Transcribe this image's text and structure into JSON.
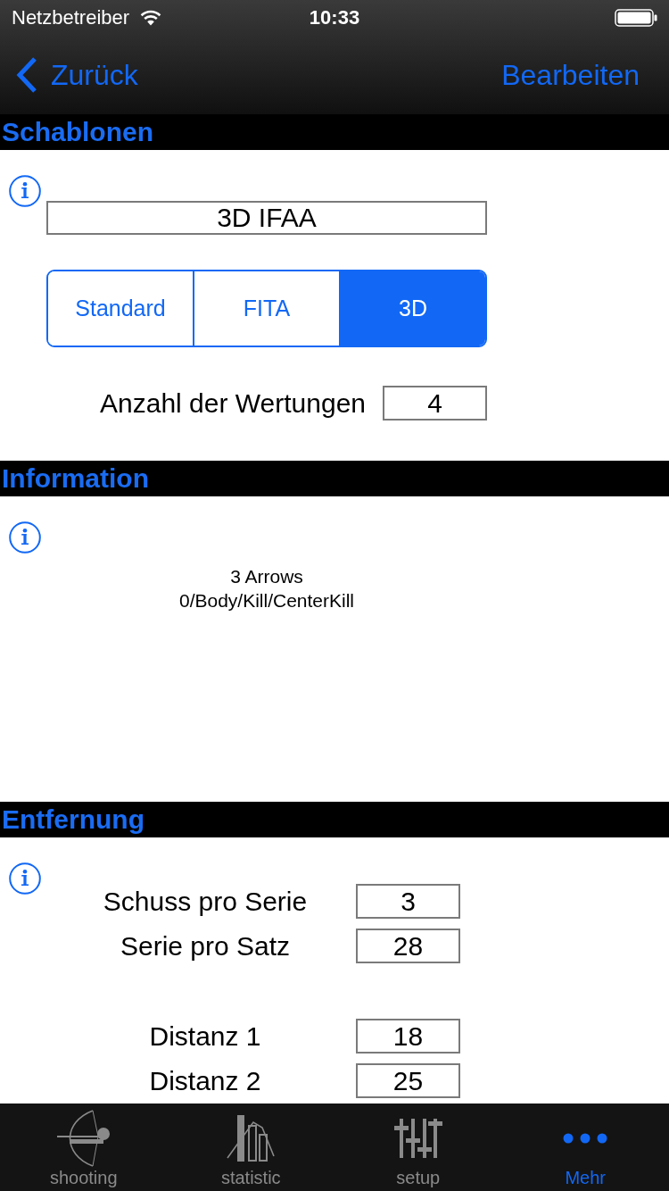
{
  "status_bar": {
    "carrier": "Netzbetreiber",
    "time": "10:33"
  },
  "nav_bar": {
    "back": "Zurück",
    "action": "Bearbeiten"
  },
  "sections": [
    {
      "kind": "template",
      "title": "Schablonen",
      "name_field": {
        "value": "3D IFAA"
      },
      "segments": [
        {
          "label": "Standard",
          "selected": false
        },
        {
          "label": "FITA",
          "selected": false
        },
        {
          "label": "3D",
          "selected": true
        }
      ],
      "count": {
        "label": "Anzahl der Wertungen",
        "value": "4"
      }
    },
    {
      "kind": "info",
      "title": "Information",
      "lines": [
        "3 Arrows",
        "0/Body/Kill/CenterKill"
      ]
    },
    {
      "kind": "distance",
      "title": "Entfernung",
      "groups": [
        {
          "rows": [
            {
              "label": "Schuss pro Serie",
              "value": "3"
            },
            {
              "label": "Serie pro Satz",
              "value": "28"
            }
          ]
        },
        {
          "rows": [
            {
              "label": "Distanz 1",
              "value": "18"
            },
            {
              "label": "Distanz 2",
              "value": "25"
            }
          ]
        }
      ]
    }
  ],
  "tab_bar": [
    {
      "label": "shooting",
      "selected": false
    },
    {
      "label": "statistic",
      "selected": false
    },
    {
      "label": "setup",
      "selected": false
    },
    {
      "label": "Mehr",
      "selected": true
    }
  ]
}
